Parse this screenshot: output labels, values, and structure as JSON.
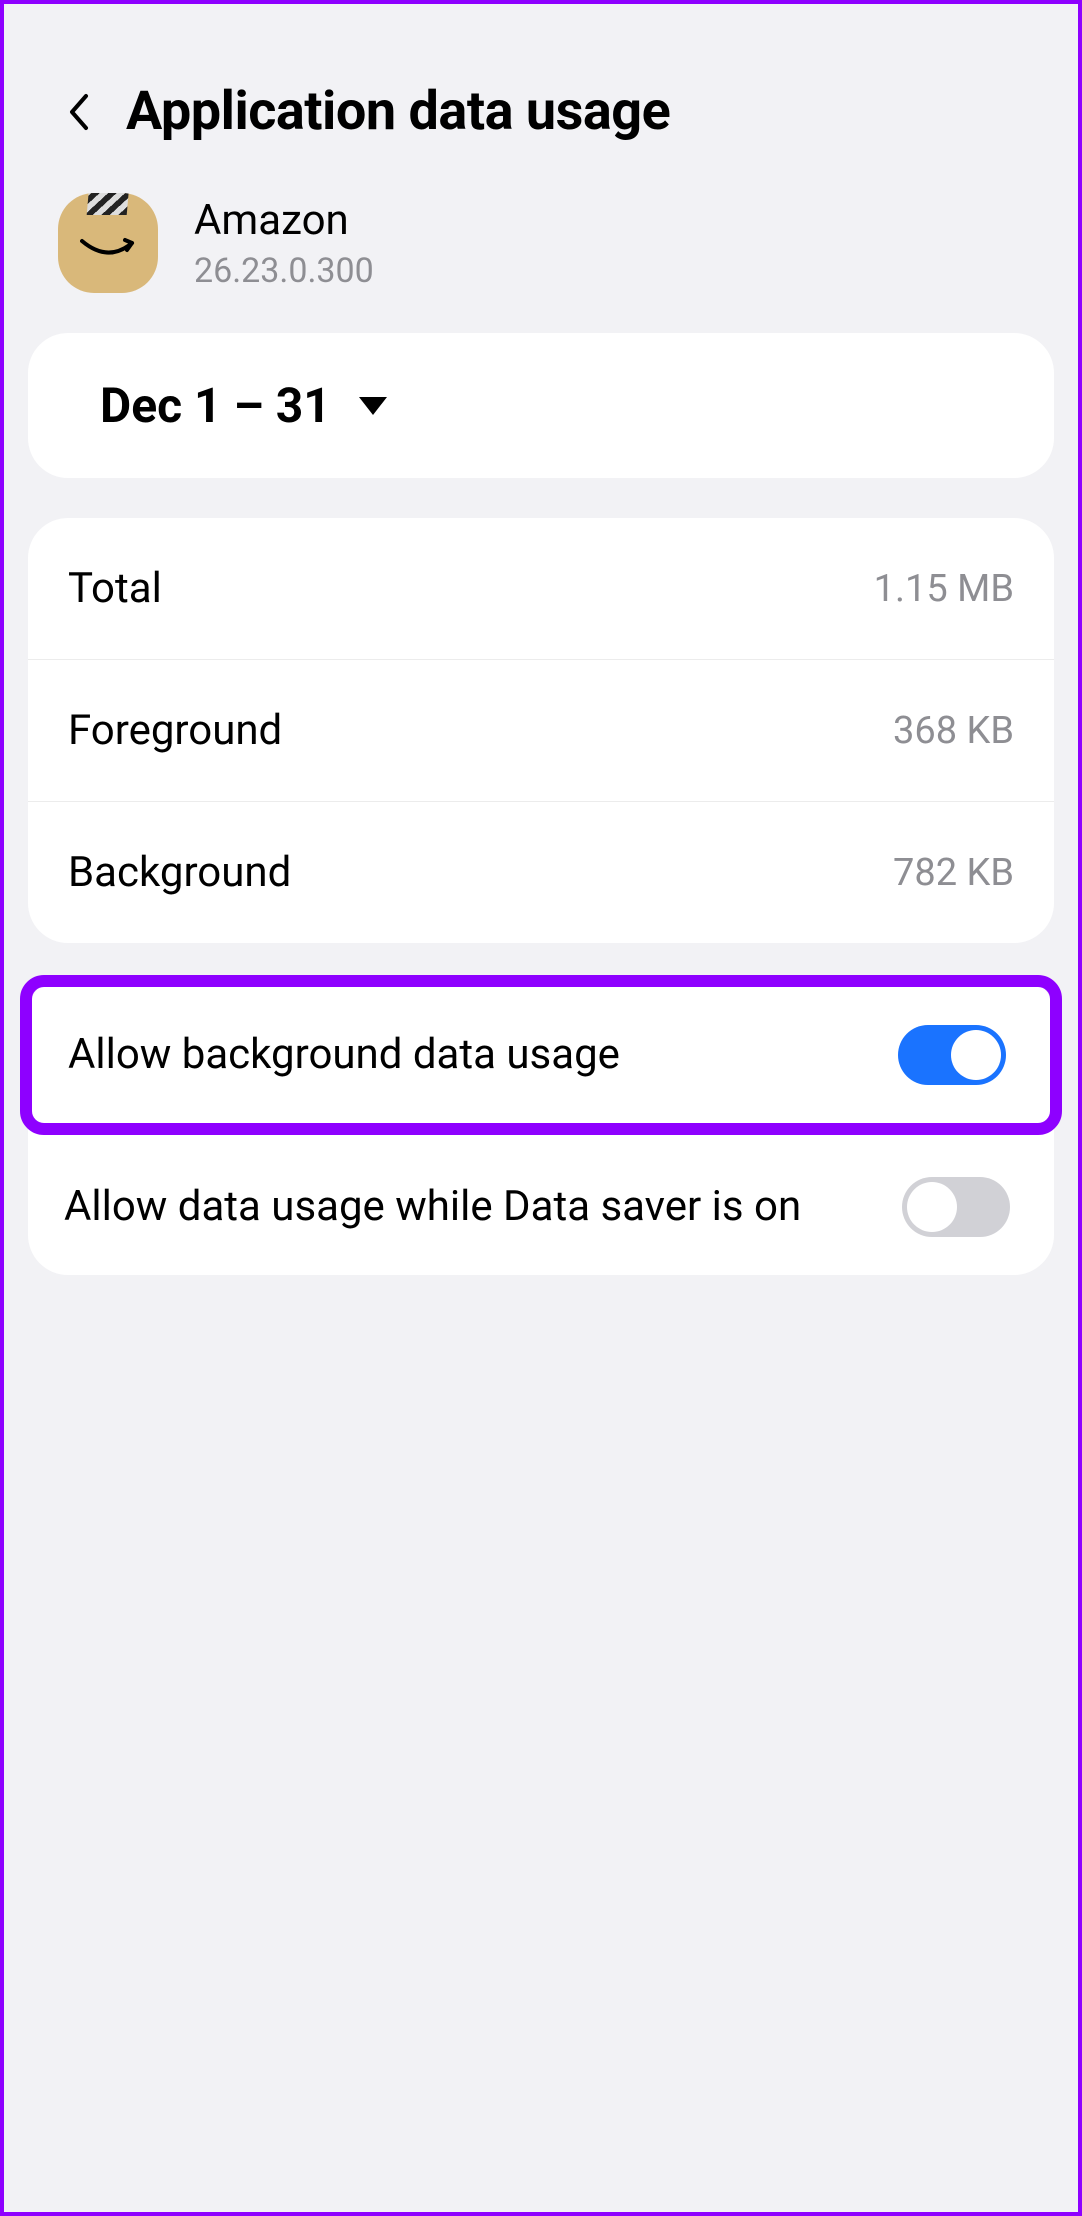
{
  "header": {
    "title": "Application data usage"
  },
  "app": {
    "name": "Amazon",
    "version": "26.23.0.300"
  },
  "date_range": {
    "label": "Dec 1 – 31"
  },
  "stats": {
    "total": {
      "label": "Total",
      "value": "1.15 MB"
    },
    "foreground": {
      "label": "Foreground",
      "value": "368 KB"
    },
    "background": {
      "label": "Background",
      "value": "782 KB"
    }
  },
  "toggles": {
    "allow_bg": {
      "label": "Allow background data usage",
      "on": true
    },
    "allow_saver": {
      "label": "Allow data usage while Data saver is on",
      "on": false
    }
  }
}
